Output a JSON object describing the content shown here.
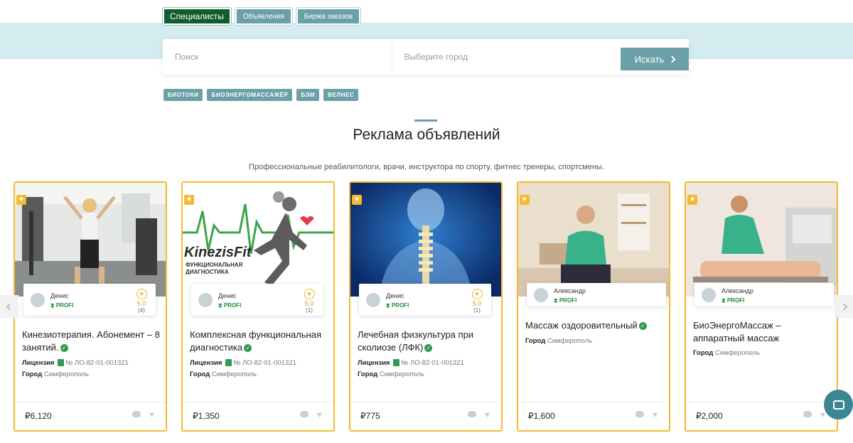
{
  "top_tabs": [
    "Специалисты",
    "Объявления",
    "Биржа заказов"
  ],
  "search": {
    "query_placeholder": "Поиск",
    "city_placeholder": "Выберите город",
    "button_label": "Искать"
  },
  "tags": [
    "БИОТОКИ",
    "БИОЭНЕРГОМАССАЖЁР",
    "БЭМ",
    "ВЕЛНЕС"
  ],
  "section": {
    "title": "Реклама объявлений",
    "subtitle": "Профессиональные реабилитологи, врачи, инструктора по спорту, фитнес тренеры, спортсмены."
  },
  "cards": [
    {
      "author": "Денис",
      "badge": "PROFI",
      "rating": "5.0",
      "rating_count": "(4)",
      "title": "Кинезиотерапия. Абонемент – 8 занятий.",
      "license_label": "Лицензия",
      "license_value": "№ ЛО-82-01-001321",
      "city_label": "Город",
      "city_value": "Симферополь",
      "price": "₽6,120"
    },
    {
      "author": "Денис",
      "badge": "PROFI",
      "rating": "5.0",
      "rating_count": "(1)",
      "title": "Комплексная функциональная диагностика",
      "license_label": "Лицензия",
      "license_value": "№ ЛО-82-01-001321",
      "city_label": "Город",
      "city_value": "Симферополь",
      "price": "₽1,350",
      "image_text": [
        "KinezisFit",
        "ФУНКЦИОНАЛЬНАЯ",
        "ДИАГНОСТИКА"
      ]
    },
    {
      "author": "Денис",
      "badge": "PROFI",
      "rating": "5.0",
      "rating_count": "(1)",
      "title": "Лечебная физкультура при сколиозе (ЛФК)",
      "license_label": "Лицензия",
      "license_value": "№ ЛО-82-01-001321",
      "city_label": "Город",
      "city_value": "Симферополь",
      "price": "₽775"
    },
    {
      "author": "Александр",
      "badge": "PROFI",
      "title": "Массаж оздоровительный",
      "city_label": "Город",
      "city_value": "Симферополь",
      "price": "₽1,600"
    },
    {
      "author": "Александр",
      "badge": "PROFI",
      "title": "БиоЭнергоМассаж – аппаратный массаж",
      "city_label": "Город",
      "city_value": "Симферополь",
      "price": "₽2,000"
    }
  ],
  "colors": {
    "accent": "#6aa0a8",
    "active_tab": "#0f5e2c",
    "featured_border": "#f5b82e",
    "verified": "#2e9b4f"
  }
}
